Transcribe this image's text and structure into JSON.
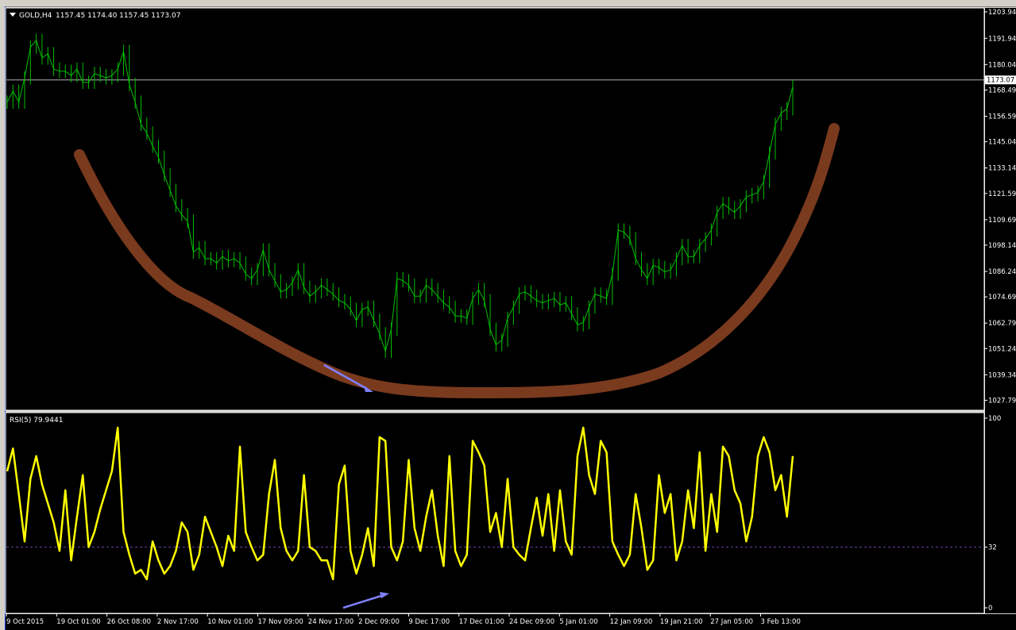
{
  "main_header": {
    "symbol": "GOLD,H4",
    "ohlc": "1157.45 1174.40 1157.45 1173.07"
  },
  "current_price": "1173.07",
  "rsi_header": "RSI(5) 79.9441",
  "colors": {
    "price": "#00c000",
    "rsi": "#ffff00",
    "curve": "#7a3a1e",
    "arrow": "#8080ff",
    "background": "#000000",
    "axis": "#ffffff",
    "level": "#6a3fa0"
  },
  "chart_data": [
    {
      "type": "line",
      "series": [
        {
          "values": [
            1163,
            1168,
            1163,
            1174,
            1188,
            1191,
            1183,
            1185,
            1178,
            1177,
            1177,
            1175,
            1178,
            1172,
            1172,
            1176,
            1175,
            1174,
            1175,
            1178,
            1186,
            1171,
            1163,
            1153,
            1149,
            1143,
            1138,
            1130,
            1123,
            1116,
            1112,
            1109,
            1095,
            1097,
            1092,
            1092,
            1090,
            1093,
            1091,
            1092,
            1090,
            1085,
            1083,
            1087,
            1096,
            1087,
            1082,
            1077,
            1078,
            1081,
            1087,
            1079,
            1075,
            1077,
            1080,
            1078,
            1076,
            1073,
            1072,
            1069,
            1064,
            1069,
            1070,
            1064,
            1058,
            1050,
            1060,
            1083,
            1082,
            1080,
            1075,
            1075,
            1080,
            1078,
            1075,
            1072,
            1070,
            1066,
            1066,
            1065,
            1074,
            1078,
            1073,
            1060,
            1053,
            1055,
            1065,
            1070,
            1076,
            1077,
            1075,
            1073,
            1072,
            1073,
            1074,
            1071,
            1072,
            1067,
            1062,
            1063,
            1070,
            1076,
            1075,
            1074,
            1085,
            1105,
            1104,
            1101,
            1092,
            1087,
            1083,
            1089,
            1088,
            1086,
            1087,
            1092,
            1098,
            1093,
            1093,
            1098,
            1101,
            1105,
            1113,
            1117,
            1115,
            1113,
            1116,
            1120,
            1121,
            1122,
            1127,
            1140,
            1153,
            1158,
            1160,
            1170
          ]
        }
      ],
      "yaxis_ticks": [
        "1203.94",
        "1191.94",
        "1180.04",
        "1168.49",
        "1156.59",
        "1145.04",
        "1133.14",
        "1121.59",
        "1109.69",
        "1098.14",
        "1086.24",
        "1074.69",
        "1062.79",
        "1051.24",
        "1039.34",
        "1027.79"
      ],
      "ylim": [
        1024,
        1205
      ],
      "xaxis_ticks": [
        "9 Oct 2015",
        "19 Oct 01:00",
        "26 Oct 08:00",
        "2 Nov 17:00",
        "10 Nov 01:00",
        "17 Nov 09:00",
        "24 Nov 17:00",
        "2 Dec 09:00",
        "9 Dec 17:00",
        "17 Dec 01:00",
        "24 Dec 09:00",
        "5 Jan 01:00",
        "12 Jan 09:00",
        "19 Jan 21:00",
        "27 Jan 05:00",
        "3 Feb 13:00"
      ],
      "current_level": 1173.07
    },
    {
      "type": "line",
      "series": [
        {
          "values": [
            72,
            84,
            60,
            35,
            68,
            80,
            65,
            55,
            45,
            30,
            62,
            25,
            48,
            70,
            32,
            40,
            52,
            62,
            72,
            95,
            40,
            28,
            18,
            20,
            15,
            35,
            25,
            18,
            22,
            30,
            45,
            40,
            20,
            28,
            48,
            40,
            32,
            22,
            38,
            30,
            85,
            40,
            32,
            25,
            28,
            60,
            78,
            42,
            30,
            25,
            30,
            70,
            32,
            30,
            25,
            25,
            15,
            65,
            75,
            30,
            18,
            28,
            42,
            22,
            90,
            88,
            32,
            25,
            35,
            78,
            42,
            30,
            48,
            62,
            38,
            22,
            80,
            30,
            22,
            28,
            88,
            82,
            75,
            40,
            50,
            32,
            68,
            32,
            28,
            25,
            42,
            58,
            38,
            60,
            30,
            62,
            35,
            28,
            80,
            95,
            70,
            60,
            88,
            82,
            35,
            28,
            22,
            28,
            60,
            42,
            20,
            25,
            70,
            50,
            60,
            25,
            35,
            62,
            42,
            82,
            30,
            60,
            40,
            85,
            80,
            62,
            55,
            35,
            48,
            80,
            90,
            82,
            62,
            70,
            48,
            80
          ]
        }
      ],
      "yaxis_ticks": [
        "100",
        "32",
        "0"
      ],
      "ylim": [
        0,
        100
      ],
      "level": 32
    }
  ]
}
